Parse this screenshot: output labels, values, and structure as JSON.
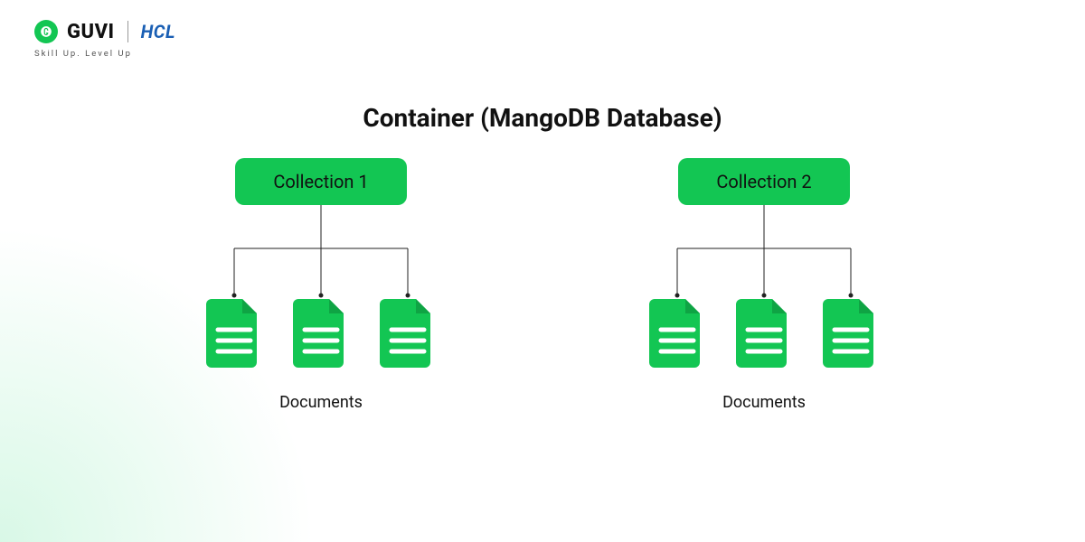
{
  "logo": {
    "guvi": "GUVI",
    "hcl": "HCL",
    "tagline": "Skill Up. Level Up"
  },
  "title": "Container (MangoDB Database)",
  "collections": [
    {
      "label": "Collection 1",
      "docs_label": "Documents",
      "doc_count": 3
    },
    {
      "label": "Collection 2",
      "docs_label": "Documents",
      "doc_count": 3
    }
  ],
  "colors": {
    "accent": "#13c653",
    "hcl_blue": "#1a5fb4"
  }
}
